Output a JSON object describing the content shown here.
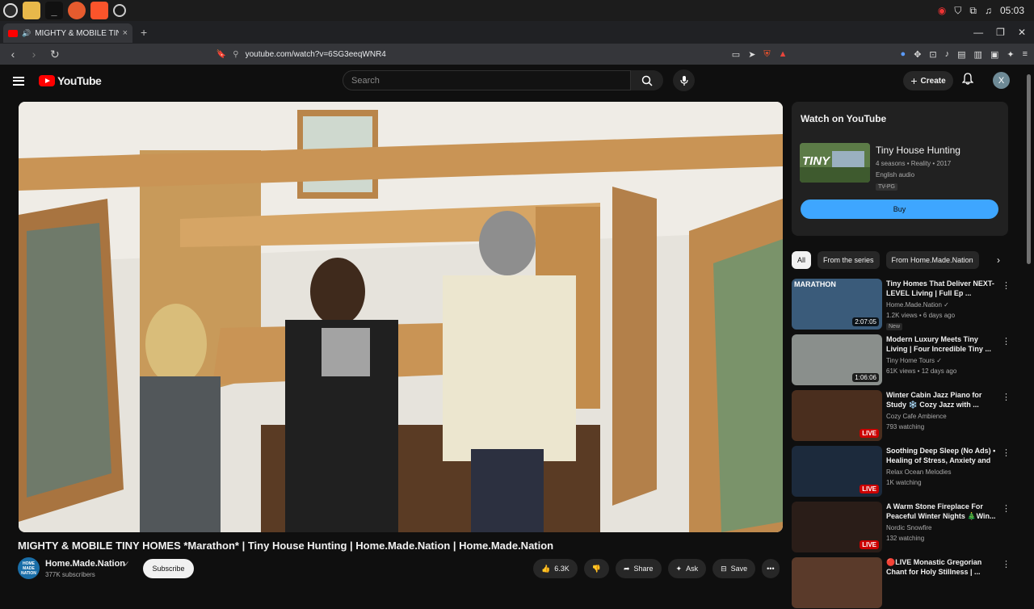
{
  "taskbar": {
    "clock": "05:03"
  },
  "browser": {
    "tab_title": "MIGHTY & MOBILE TINY H",
    "tab_close": "×",
    "new_tab": "+",
    "url": "youtube.com/watch?v=6SG3eeqWNR4"
  },
  "header": {
    "logo": "YouTube",
    "search_placeholder": "Search",
    "create_label": "Create",
    "avatar_letter": "X"
  },
  "video": {
    "title": "MIGHTY & MOBILE TINY HOMES *Marathon* | Tiny House Hunting | Home.Made.Nation | Home.Made.Nation",
    "channel_name": "Home.Made.Nation",
    "channel_avatar_text": "HOME MADE NATION",
    "subscribers": "377K subscribers",
    "subscribe_label": "Subscribe",
    "likes": "6.3K",
    "share_label": "Share",
    "ask_label": "Ask",
    "save_label": "Save"
  },
  "watch_panel": {
    "heading": "Watch on YouTube",
    "show_title": "Tiny House Hunting",
    "meta": "4 seasons • Reality • 2017",
    "audio": "English audio",
    "rating": "TV-PG",
    "buy_label": "Buy",
    "thumb_text": "TINY"
  },
  "chips": [
    "All",
    "From the series",
    "From Home.Made.Nation"
  ],
  "recommendations": [
    {
      "title": "Tiny Homes That Deliver NEXT-LEVEL Living | Full Ep ...",
      "channel": "Home.Made.Nation ✓",
      "stats": "1.2K views • 6 days ago",
      "badge": "New",
      "overlay": "2:07:05",
      "thumb_text": "MARATHON",
      "live": false,
      "color": "#3a5b7a"
    },
    {
      "title": "Modern Luxury Meets Tiny Living | Four Incredible Tiny ...",
      "channel": "Tiny Home Tours ✓",
      "stats": "61K views • 12 days ago",
      "badge": "",
      "overlay": "1:06:06",
      "thumb_text": "",
      "live": false,
      "color": "#8a8f8c"
    },
    {
      "title": "Winter Cabin Jazz Piano for Study ❄️ Cozy Jazz with ...",
      "channel": "Cozy Cafe Ambience",
      "stats": "793 watching",
      "badge": "",
      "overlay": "LIVE",
      "thumb_text": "",
      "live": true,
      "color": "#4a2e1e"
    },
    {
      "title": "Soothing Deep Sleep (No Ads) • Healing of Stress, Anxiety and ...",
      "channel": "Relax Ocean Melodies",
      "stats": "1K watching",
      "badge": "",
      "overlay": "LIVE",
      "thumb_text": "",
      "live": true,
      "color": "#1c2a3c"
    },
    {
      "title": "A Warm Stone Fireplace For Peaceful Winter Nights 🎄Win...",
      "channel": "Nordic Snowfire",
      "stats": "132 watching",
      "badge": "",
      "overlay": "LIVE",
      "thumb_text": "",
      "live": true,
      "color": "#2a1d18"
    },
    {
      "title": "🔴LIVE Monastic Gregorian Chant for Holy Stillness | ...",
      "channel": "",
      "stats": "",
      "badge": "",
      "overlay": "",
      "thumb_text": "",
      "live": false,
      "color": "#5a3a2a"
    }
  ]
}
